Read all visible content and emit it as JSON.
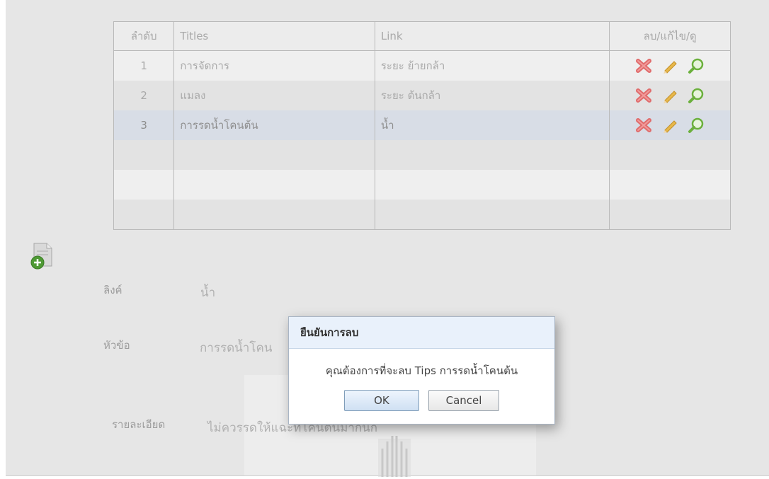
{
  "table": {
    "headers": [
      "ลำดับ",
      "Titles",
      "Link",
      "ลบ/แก้ไข/ดู"
    ],
    "rows": [
      {
        "no": "1",
        "title": "การจัดการ",
        "link": "ระยะ ย้ายกล้า"
      },
      {
        "no": "2",
        "title": "แมลง",
        "link": "ระยะ ต้นกล้า"
      },
      {
        "no": "3",
        "title": "การรดน้ำโคนต้น",
        "link": "น้ำ"
      }
    ],
    "selected_row": 3
  },
  "icons": {
    "delete": "delete-x-icon",
    "edit": "pencil-icon",
    "view": "magnifier-icon",
    "add": "add-document-icon"
  },
  "form": {
    "link_label": "ลิงค์",
    "link_value": "น้ำ",
    "title_label": "หัวข้อ",
    "title_value": "การรดน้ำโคน",
    "detail_label": "รายละเอียด",
    "detail_value": "ไม่ควรรดให้แฉะที่โคนต้นมากนัก"
  },
  "dialog": {
    "title": "ยืนยันการลบ",
    "message": "คุณต้องการที่จะลบ Tips การรดน้ำโคนต้น",
    "ok_label": "OK",
    "cancel_label": "Cancel"
  },
  "colors": {
    "delete": "#e06c6c",
    "edit": "#e8b84a",
    "view": "#6bb03c",
    "dialog_header": "#e9f1fb"
  }
}
